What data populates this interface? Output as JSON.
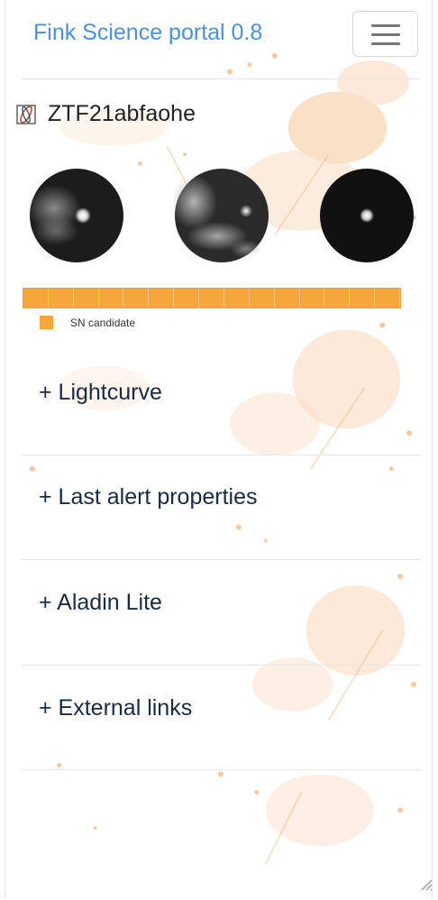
{
  "navbar": {
    "brand": "Fink Science portal 0.8",
    "toggler_icon": "hamburger-icon"
  },
  "object": {
    "name": "ZTF21abfaohe",
    "icon": "object-logo-icon"
  },
  "cutouts": [
    {
      "name": "science-cutout"
    },
    {
      "name": "template-cutout"
    },
    {
      "name": "difference-cutout"
    }
  ],
  "classification": {
    "segments": 15,
    "color": "#f5a83a",
    "legend": [
      {
        "label": "SN candidate",
        "color": "#f5a83a"
      }
    ]
  },
  "accordion": [
    {
      "label": "+ Lightcurve"
    },
    {
      "label": "+ Last alert properties"
    },
    {
      "label": "+ Aladin Lite"
    },
    {
      "label": "+ External links"
    }
  ],
  "colors": {
    "brand": "#4a90e2",
    "accent": "#f5a83a",
    "heading": "#1a2a44"
  }
}
